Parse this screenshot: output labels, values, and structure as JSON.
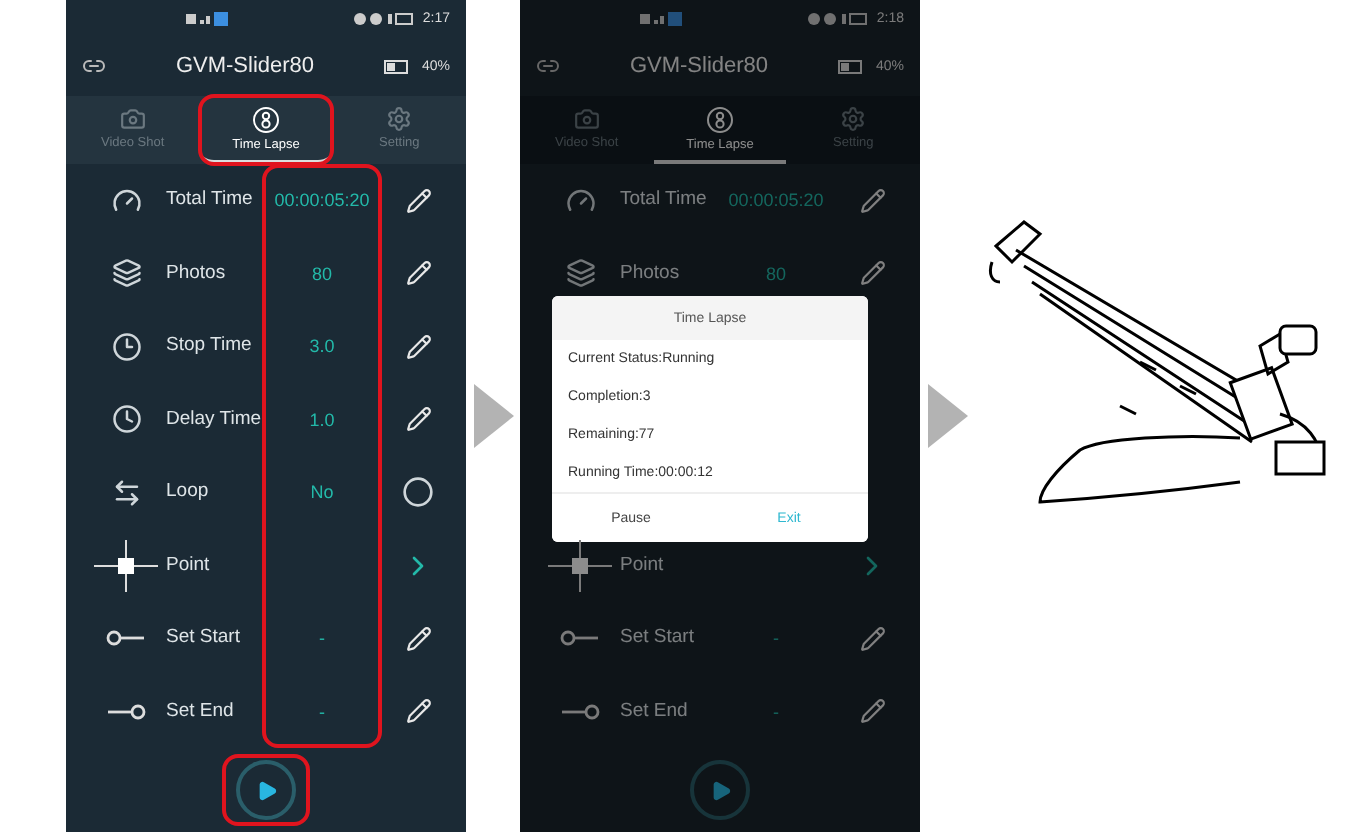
{
  "phones": [
    {
      "status_time": "2:17",
      "title": "GVM-Slider80",
      "battery": "40%",
      "dimmed": false,
      "value_column_highlighted": true,
      "play_highlighted": true,
      "tabs": [
        {
          "label": "Video Shot",
          "selected": false,
          "highlighted": false
        },
        {
          "label": "Time Lapse",
          "selected": true,
          "highlighted": true
        },
        {
          "label": "Setting",
          "selected": false,
          "highlighted": false
        }
      ],
      "rows": [
        {
          "kind": "duration",
          "label": "Total Time",
          "value": "00:00:05:20"
        },
        {
          "kind": "count",
          "label": "Photos",
          "value": "80"
        },
        {
          "kind": "interval",
          "label": "Stop Time",
          "value": "3.0"
        },
        {
          "kind": "delay",
          "label": "Delay Time",
          "value": "1.0"
        },
        {
          "kind": "loop",
          "label": "Loop",
          "value": "No"
        },
        {
          "kind": "point",
          "label": "Point"
        },
        {
          "kind": "start",
          "label": "Set Start",
          "value": "-"
        },
        {
          "kind": "end",
          "label": "Set End",
          "value": "-"
        }
      ]
    },
    {
      "status_time": "2:18",
      "title": "GVM-Slider80",
      "battery": "40%",
      "dimmed": true,
      "value_column_highlighted": false,
      "play_highlighted": false,
      "tabs": [
        {
          "label": "Video Shot",
          "selected": false,
          "highlighted": false
        },
        {
          "label": "Time Lapse",
          "selected": true,
          "highlighted": false
        },
        {
          "label": "Setting",
          "selected": false,
          "highlighted": false
        }
      ],
      "rows": [
        {
          "kind": "duration",
          "label": "Total Time",
          "value": "00:00:05:20"
        },
        {
          "kind": "count",
          "label": "Photos",
          "value": "80"
        },
        {
          "kind": "dialog",
          "title": "Time Lapse",
          "lines": [
            "Current Status:Running",
            "Completion:3",
            "Remaining:77",
            "Running Time:00:00:12"
          ],
          "buttons": [
            {
              "label": "Pause",
              "primary": false
            },
            {
              "label": "Exit",
              "primary": true
            }
          ]
        },
        {
          "kind": "point",
          "label": "Point"
        },
        {
          "kind": "start",
          "label": "Set Start",
          "value": "-"
        },
        {
          "kind": "end",
          "label": "Set End",
          "value": "-"
        }
      ]
    }
  ]
}
